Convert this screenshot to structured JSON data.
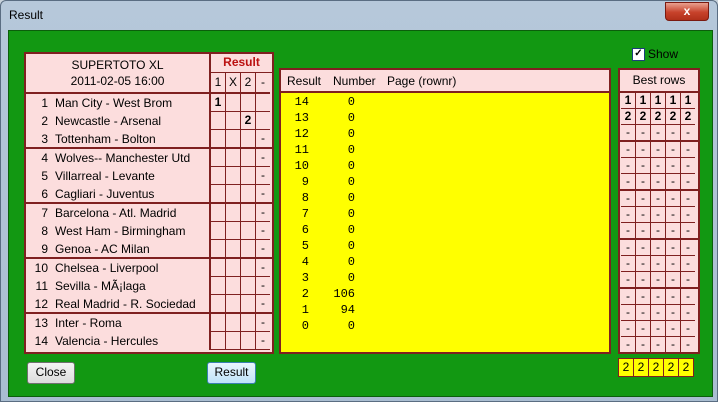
{
  "window": {
    "title": "Result",
    "close_glyph": "x"
  },
  "left_table": {
    "title": "SUPERTOTO XL",
    "datetime": "2011-02-05 16:00",
    "result_header": "Result",
    "subheaders": [
      "1",
      "X",
      "2",
      "-"
    ],
    "rows": [
      {
        "num": "1",
        "match": "Man City - West Brom",
        "c": [
          "1",
          "",
          "",
          ""
        ]
      },
      {
        "num": "2",
        "match": "Newcastle - Arsenal",
        "c": [
          "",
          "",
          "2",
          ""
        ]
      },
      {
        "num": "3",
        "match": "Tottenham - Bolton",
        "c": [
          "",
          "",
          "",
          "-"
        ]
      },
      {
        "num": "4",
        "match": "Wolves-- Manchester Utd",
        "c": [
          "",
          "",
          "",
          "-"
        ]
      },
      {
        "num": "5",
        "match": "Villarreal - Levante",
        "c": [
          "",
          "",
          "",
          "-"
        ]
      },
      {
        "num": "6",
        "match": "Cagliari - Juventus",
        "c": [
          "",
          "",
          "",
          "-"
        ]
      },
      {
        "num": "7",
        "match": "Barcelona - Atl. Madrid",
        "c": [
          "",
          "",
          "",
          "-"
        ]
      },
      {
        "num": "8",
        "match": "West Ham - Birmingham",
        "c": [
          "",
          "",
          "",
          "-"
        ]
      },
      {
        "num": "9",
        "match": "Genoa - AC Milan",
        "c": [
          "",
          "",
          "",
          "-"
        ]
      },
      {
        "num": "10",
        "match": "Chelsea - Liverpool",
        "c": [
          "",
          "",
          "",
          "-"
        ]
      },
      {
        "num": "11",
        "match": "Sevilla - MÃ¡laga",
        "c": [
          "",
          "",
          "",
          "-"
        ]
      },
      {
        "num": "12",
        "match": "Real Madrid - R. Sociedad",
        "c": [
          "",
          "",
          "",
          "-"
        ]
      },
      {
        "num": "13",
        "match": "Inter - Roma",
        "c": [
          "",
          "",
          "",
          "-"
        ]
      },
      {
        "num": "14",
        "match": "Valencia - Hercules",
        "c": [
          "",
          "",
          "",
          "-"
        ]
      }
    ]
  },
  "middle_list": {
    "header": {
      "result": "Result",
      "number": "Number",
      "page": "Page (rownr)"
    },
    "rows": [
      {
        "result": "14",
        "number": "0"
      },
      {
        "result": "13",
        "number": "0"
      },
      {
        "result": "12",
        "number": "0"
      },
      {
        "result": "11",
        "number": "0"
      },
      {
        "result": "10",
        "number": "0"
      },
      {
        "result": "9",
        "number": "0"
      },
      {
        "result": "8",
        "number": "0"
      },
      {
        "result": "7",
        "number": "0"
      },
      {
        "result": "6",
        "number": "0"
      },
      {
        "result": "5",
        "number": "0"
      },
      {
        "result": "4",
        "number": "0"
      },
      {
        "result": "3",
        "number": "0"
      },
      {
        "result": "2",
        "number": "106"
      },
      {
        "result": "1",
        "number": "94"
      },
      {
        "result": "0",
        "number": "0"
      }
    ]
  },
  "show_checkbox": {
    "label": "Show",
    "checked": true,
    "check_glyph": "✓"
  },
  "best_rows": {
    "header": "Best rows",
    "rows": [
      [
        "1",
        "1",
        "1",
        "1",
        "1"
      ],
      [
        "2",
        "2",
        "2",
        "2",
        "2"
      ],
      [
        "-",
        "-",
        "-",
        "-",
        "-"
      ],
      [
        "-",
        "-",
        "-",
        "-",
        "-"
      ],
      [
        "-",
        "-",
        "-",
        "-",
        "-"
      ],
      [
        "-",
        "-",
        "-",
        "-",
        "-"
      ],
      [
        "-",
        "-",
        "-",
        "-",
        "-"
      ],
      [
        "-",
        "-",
        "-",
        "-",
        "-"
      ],
      [
        "-",
        "-",
        "-",
        "-",
        "-"
      ],
      [
        "-",
        "-",
        "-",
        "-",
        "-"
      ],
      [
        "-",
        "-",
        "-",
        "-",
        "-"
      ],
      [
        "-",
        "-",
        "-",
        "-",
        "-"
      ],
      [
        "-",
        "-",
        "-",
        "-",
        "-"
      ],
      [
        "-",
        "-",
        "-",
        "-",
        "-"
      ],
      [
        "-",
        "-",
        "-",
        "-",
        "-"
      ],
      [
        "-",
        "-",
        "-",
        "-",
        "-"
      ]
    ],
    "bottom": [
      "2",
      "2",
      "2",
      "2",
      "2"
    ]
  },
  "buttons": {
    "close": "Close",
    "result": "Result"
  },
  "colors": {
    "client_bg": "#129812",
    "list_bg": "#ffff00",
    "table_bg": "#fcdddd",
    "border": "#7f2020"
  }
}
